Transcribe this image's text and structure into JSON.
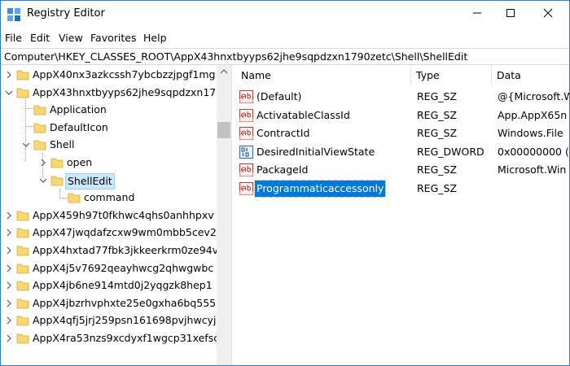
{
  "window": {
    "title": "Registry Editor",
    "icon": "registry-editor-icon",
    "controls": [
      "minimize-icon",
      "maximize-icon",
      "close-icon"
    ]
  },
  "menu": [
    "File",
    "Edit",
    "View",
    "Favorites",
    "Help"
  ],
  "address": "Computer\\HKEY_CLASSES_ROOT\\AppX43hnxtbyyps62jhe9sqpdzxn1790zetc\\Shell\\ShellEdit",
  "tree": [
    {
      "label": "AppX40nx3azkcssh7ybcbzzjpgf1mg",
      "toggle": "collapsed"
    },
    {
      "label": "AppX43hnxtbyyps62jhe9sqpdzxn17",
      "toggle": "expanded"
    },
    {
      "label": "Application",
      "toggle": "none"
    },
    {
      "label": "DefaultIcon",
      "toggle": "none"
    },
    {
      "label": "Shell",
      "toggle": "expanded"
    },
    {
      "label": "open",
      "toggle": "collapsed"
    },
    {
      "label": "ShellEdit",
      "toggle": "expanded",
      "selected": true
    },
    {
      "label": "command",
      "toggle": "none"
    },
    {
      "label": "AppX459h97t0fkhwc4qhs0anhhpxv",
      "toggle": "collapsed"
    },
    {
      "label": "AppX47jwqdafzcxw9wm0mbb5cev2",
      "toggle": "collapsed"
    },
    {
      "label": "AppX4hxtad77fbk3jkkeerkrm0ze94v",
      "toggle": "collapsed"
    },
    {
      "label": "AppX4j5v7692qeayhwcg2qhwgwbc",
      "toggle": "collapsed"
    },
    {
      "label": "AppX4jb6ne914mtd0j2yqgzk8hep1",
      "toggle": "collapsed"
    },
    {
      "label": "AppX4jbzrhvphxte25e0gxha6bq555",
      "toggle": "collapsed"
    },
    {
      "label": "AppX4qfj5jrj259psn161698pvjhwcyj",
      "toggle": "collapsed"
    },
    {
      "label": "AppX4ra53nzs9xcdyxf1wgcp31xefsc",
      "toggle": "collapsed"
    }
  ],
  "columns": {
    "name": "Name",
    "type": "Type",
    "data": "Data"
  },
  "values": [
    {
      "name": "(Default)",
      "type": "REG_SZ",
      "data": "@{Microsoft.W",
      "icon": "string-value-icon"
    },
    {
      "name": "ActivatableClassId",
      "type": "REG_SZ",
      "data": "App.AppX65n",
      "icon": "string-value-icon"
    },
    {
      "name": "ContractId",
      "type": "REG_SZ",
      "data": "Windows.File",
      "icon": "string-value-icon"
    },
    {
      "name": "DesiredInitialViewState",
      "type": "REG_DWORD",
      "data": "0x00000000 (0",
      "icon": "binary-value-icon"
    },
    {
      "name": "PackageId",
      "type": "REG_SZ",
      "data": "Microsoft.Win",
      "icon": "string-value-icon"
    },
    {
      "name": "Programmaticaccessonly",
      "type": "REG_SZ",
      "data": "",
      "icon": "string-value-icon",
      "selected": true
    }
  ],
  "colors": {
    "selection": "#0078d7",
    "tree_selection": "#cce8ff",
    "folder": "#f8d775"
  }
}
